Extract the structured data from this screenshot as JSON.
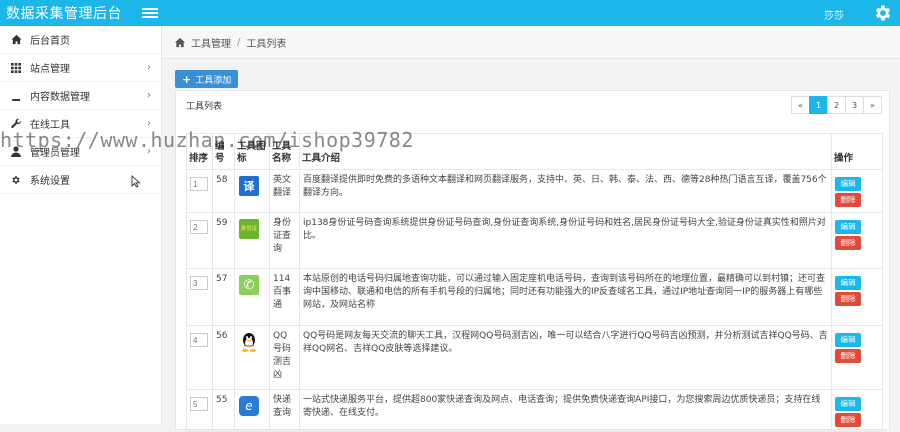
{
  "header": {
    "title": "数据采集管理后台",
    "user": "莎莎"
  },
  "sidebar": {
    "items": [
      {
        "label": "后台首页",
        "icon": "home-icon",
        "chevron": ""
      },
      {
        "label": "站点管理",
        "icon": "grid-icon",
        "chevron": "›"
      },
      {
        "label": "内容数据管理",
        "icon": "book-icon",
        "chevron": "›"
      },
      {
        "label": "在线工具",
        "icon": "wrench-icon",
        "chevron": "›"
      },
      {
        "label": "管理员管理",
        "icon": "user-icon",
        "chevron": "›"
      },
      {
        "label": "系统设置",
        "icon": "gear-icon",
        "chevron": ""
      }
    ]
  },
  "breadcrumb": {
    "root": "工具管理",
    "sep": "/",
    "current": "工具列表"
  },
  "toolbar": {
    "add_label": "工具添加"
  },
  "panel": {
    "title": "工具列表"
  },
  "pagination": {
    "prev": "«",
    "pages": [
      "1",
      "2",
      "3"
    ],
    "next": "»",
    "active": "1"
  },
  "table": {
    "headers": {
      "sort": "排序",
      "id": "编号",
      "icon": "工具图标",
      "name": "工具名称",
      "desc": "工具介绍",
      "action": "操作"
    },
    "edit_label": "编辑",
    "delete_label": "删除",
    "rows": [
      {
        "sort": "1",
        "id": "58",
        "name": "英文翻译",
        "logo_text": "译",
        "logo_color": "#1e6fd0",
        "desc": "百度翻译提供即时免费的多语种文本翻译和网页翻译服务，支持中、英、日、韩、泰、法、西、德等28种热门语言互译，覆盖756个翻译方向。"
      },
      {
        "sort": "2",
        "id": "59",
        "name": "身份证查询",
        "logo_text": "身份证",
        "logo_color": "#6cb52e",
        "desc": "ip138身份证号码查询系统提供身份证号码查询,身份证查询系统,身份证号码和姓名,居民身份证号码大全,验证身份证真实性和照片对比。"
      },
      {
        "sort": "3",
        "id": "57",
        "name": "114百事通",
        "logo_text": "✆",
        "logo_color": "#8bcf5a",
        "desc": "本站原创的电话号码归属地查询功能，可以通过输入固定座机电话号码，查询到该号码所在的地理位置，最精确可以到村镇；还可查询中国移动、联通和电信的所有手机号段的归属地；同时还有功能强大的IP反查域名工具，通过IP地址查询同一IP的服务器上有哪些网站，及网站名称"
      },
      {
        "sort": "4",
        "id": "56",
        "name": "QQ号码测吉凶",
        "logo_text": "QQ",
        "logo_color": "#ffffff",
        "desc": "QQ号码是网友每天交流的聊天工具，汉程网QQ号码测吉凶，唯一可以结合八字进行QQ号码吉凶预测，并分析测试吉祥QQ号码、吉祥QQ网名、吉祥QQ皮肤等选择建议。"
      },
      {
        "sort": "5",
        "id": "55",
        "name": "快递查询",
        "logo_text": "e",
        "logo_color": "#2a7bd1",
        "desc": "一站式快递服务平台，提供超800家快递查询及网点、电话查询；提供免费快递查询API接口，为您搜索周边优质快递员；支持在线寄快递、在线支付。"
      }
    ]
  },
  "watermark": "https://www.huzhan.com/ishop39782"
}
